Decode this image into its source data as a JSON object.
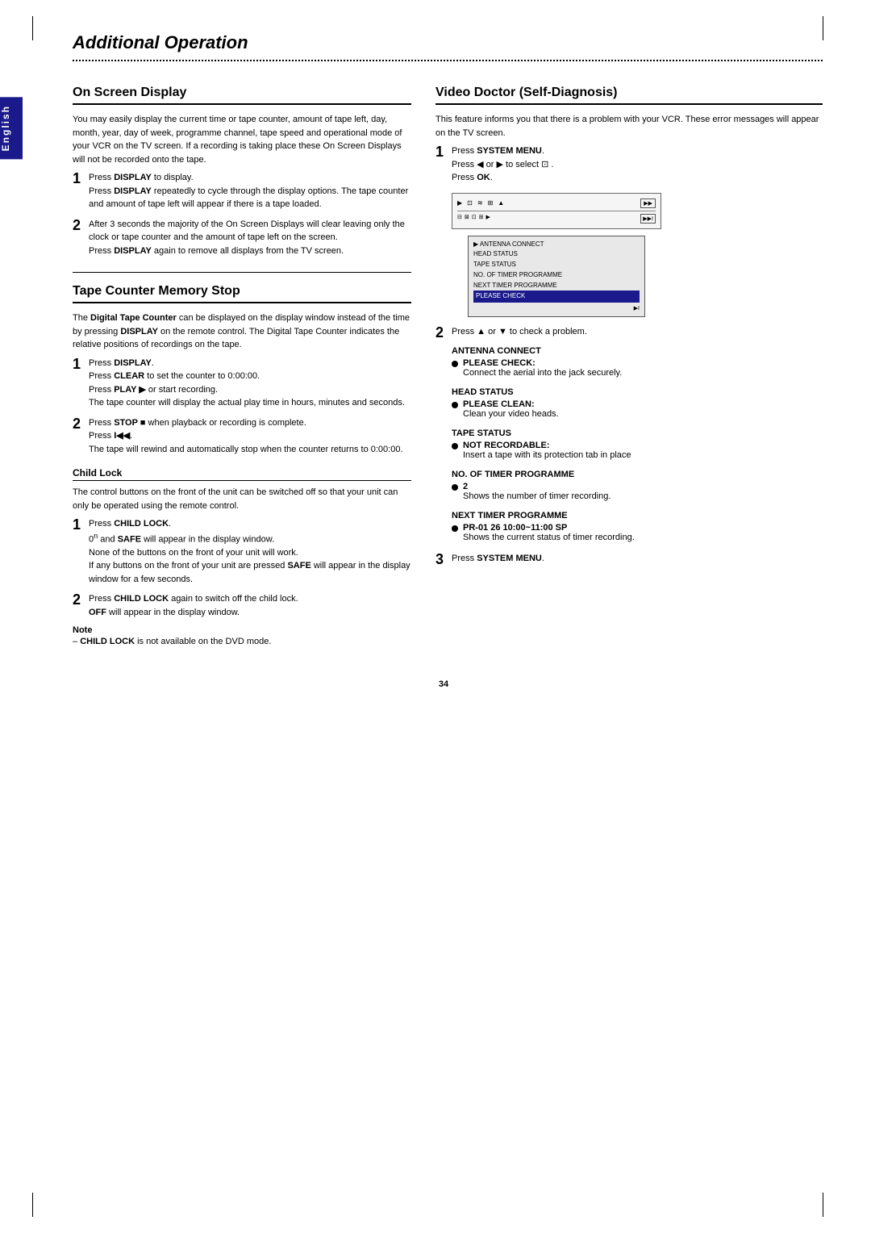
{
  "page": {
    "title": "Additional Operation",
    "page_number": "34",
    "language": "English"
  },
  "sections": {
    "on_screen_display": {
      "title": "On Screen Display",
      "intro": "You may easily display the current time or tape counter, amount of tape left, day, month, year, day of week, programme channel, tape speed and operational mode of your VCR on the TV screen. If a recording is taking place these On Screen Displays will not be recorded onto the tape.",
      "steps": [
        {
          "num": "1",
          "lines": [
            {
              "text": "Press ",
              "bold": false
            },
            {
              "text": "DISPLAY",
              "bold": true
            },
            {
              "text": " to display.",
              "bold": false
            },
            {
              "br": true
            },
            {
              "text": "Press ",
              "bold": false
            },
            {
              "text": "DISPLAY",
              "bold": true
            },
            {
              "text": " repeatedly to cycle through the display options. The tape counter and amount of tape left will appear if there is a tape loaded.",
              "bold": false
            }
          ]
        },
        {
          "num": "2",
          "lines": [
            {
              "text": "After 3 seconds the majority of the On Screen Displays will clear leaving only the clock or tape counter and the amount of tape left on the screen.",
              "bold": false
            },
            {
              "br": true
            },
            {
              "text": "Press ",
              "bold": false
            },
            {
              "text": "DISPLAY",
              "bold": true
            },
            {
              "text": " again to remove all displays from the TV screen.",
              "bold": false
            }
          ]
        }
      ]
    },
    "tape_counter": {
      "title": "Tape Counter Memory Stop",
      "intro": "The Digital Tape Counter can be displayed on the display window instead of the time by pressing DISPLAY on the remote control. The Digital Tape Counter indicates the relative positions of recordings on the tape.",
      "intro_bold_word": "Digital Tape Counter",
      "intro_display_bold": "DISPLAY",
      "steps": [
        {
          "num": "1",
          "lines": [
            {
              "text": "Press ",
              "bold": false
            },
            {
              "text": "DISPLAY",
              "bold": true
            },
            {
              "text": ".",
              "bold": false
            },
            {
              "br": true
            },
            {
              "text": "Press ",
              "bold": false
            },
            {
              "text": "CLEAR",
              "bold": true
            },
            {
              "text": " to set the counter to 0:00:00.",
              "bold": false
            },
            {
              "br": true
            },
            {
              "text": "Press ",
              "bold": false
            },
            {
              "text": "PLAY ▶",
              "bold": true
            },
            {
              "text": " or start recording.",
              "bold": false
            },
            {
              "br": true
            },
            {
              "text": "The tape counter will display the actual play time in hours, minutes and seconds.",
              "bold": false
            }
          ]
        },
        {
          "num": "2",
          "lines": [
            {
              "text": "Press ",
              "bold": false
            },
            {
              "text": "STOP ■",
              "bold": true
            },
            {
              "text": " when playback or recording is complete.",
              "bold": false
            },
            {
              "br": true
            },
            {
              "text": "Press ",
              "bold": false
            },
            {
              "text": "I◀◀",
              "bold": true
            },
            {
              "text": ".",
              "bold": false
            },
            {
              "br": true
            },
            {
              "text": "The tape will rewind and automatically stop when the counter returns to 0:00:00.",
              "bold": false
            }
          ]
        }
      ],
      "child_lock": {
        "title": "Child Lock",
        "intro": "The control buttons on the front of the unit can be switched off so that your unit can only be operated using the remote control.",
        "steps": [
          {
            "num": "1",
            "lines": [
              {
                "text": "Press ",
                "bold": false
              },
              {
                "text": "CHILD LOCK",
                "bold": true
              },
              {
                "text": ".",
                "bold": false
              },
              {
                "br": true
              },
              {
                "text": "0",
                "bold": false
              },
              {
                "sup": "n"
              },
              {
                "text": " and ",
                "bold": false
              },
              {
                "text": "SAFE",
                "bold": true
              },
              {
                "text": " will appear in the display window.",
                "bold": false
              },
              {
                "br": true
              },
              {
                "text": "None of the  buttons on the front of your unit will work.",
                "bold": false
              },
              {
                "br": true
              },
              {
                "text": "If any buttons on the front of your unit are pressed ",
                "bold": false
              },
              {
                "text": "SAFE",
                "bold": true
              },
              {
                "text": " will appear in the display window for a few seconds.",
                "bold": false
              }
            ]
          },
          {
            "num": "2",
            "lines": [
              {
                "text": "Press ",
                "bold": false
              },
              {
                "text": "CHILD LOCK",
                "bold": true
              },
              {
                "text": " again to switch off the child lock.",
                "bold": false
              },
              {
                "br": true
              },
              {
                "text": "OFF",
                "bold": true
              },
              {
                "text": " will appear in the display window.",
                "bold": false
              }
            ]
          }
        ],
        "note": {
          "label": "Note",
          "text": "– CHILD LOCK is not available on the DVD mode."
        }
      }
    },
    "video_doctor": {
      "title": "Video Doctor (Self-Diagnosis)",
      "intro": "This feature informs you that there is a problem with your VCR. These error messages will appear on the TV screen.",
      "steps": [
        {
          "num": "1",
          "lines": [
            {
              "text": "Press ",
              "bold": false
            },
            {
              "text": "SYSTEM MENU",
              "bold": true
            },
            {
              "text": ".",
              "bold": false
            },
            {
              "br": true
            },
            {
              "text": "Press ◀ or ▶ to select ",
              "bold": false
            },
            {
              "text": "⊡",
              "bold": false
            },
            {
              "text": " .",
              "bold": false
            },
            {
              "br": true
            },
            {
              "text": "Press ",
              "bold": false
            },
            {
              "text": "OK",
              "bold": true
            },
            {
              "text": ".",
              "bold": false
            }
          ]
        },
        {
          "num": "2",
          "lines": [
            {
              "text": "Press ▲ or ▼ to check a problem.",
              "bold": false
            }
          ]
        },
        {
          "num": "3",
          "lines": [
            {
              "text": "Press ",
              "bold": false
            },
            {
              "text": "SYSTEM MENU",
              "bold": true
            },
            {
              "text": ".",
              "bold": false
            }
          ]
        }
      ],
      "status_groups": [
        {
          "label": "ANTENNA CONNECT",
          "bullet_label": "PLEASE CHECK:",
          "text": "Connect the aerial into the jack securely."
        },
        {
          "label": "HEAD STATUS",
          "bullet_label": "PLEASE CLEAN:",
          "text": "Clean your video heads."
        },
        {
          "label": "TAPE STATUS",
          "bullet_label": "NOT RECORDABLE:",
          "text": "Insert a tape with its protection tab in place"
        },
        {
          "label": "NO. OF TIMER PROGRAMME",
          "bullet_label": "2",
          "text": "Shows the number of timer recording."
        },
        {
          "label": "NEXT TIMER PROGRAMME",
          "bullet_label": "PR-01 26 10:00~11:00 SP",
          "text": "Shows the current status of timer recording."
        }
      ],
      "vcr_display": {
        "top_icons": "▶ ⊡ ≋ ⊞ ▲",
        "menu_items": [
          "▶ ANTENNA CONNECT",
          "HEAD STATUS",
          "TAPE STATUS",
          "NO. OF TIMER PROGRAMME",
          "NEXT TIMER PROGRAMME"
        ],
        "highlight_item": "PLEASE CHECK",
        "bottom_indicator": "▶▶I"
      }
    }
  }
}
